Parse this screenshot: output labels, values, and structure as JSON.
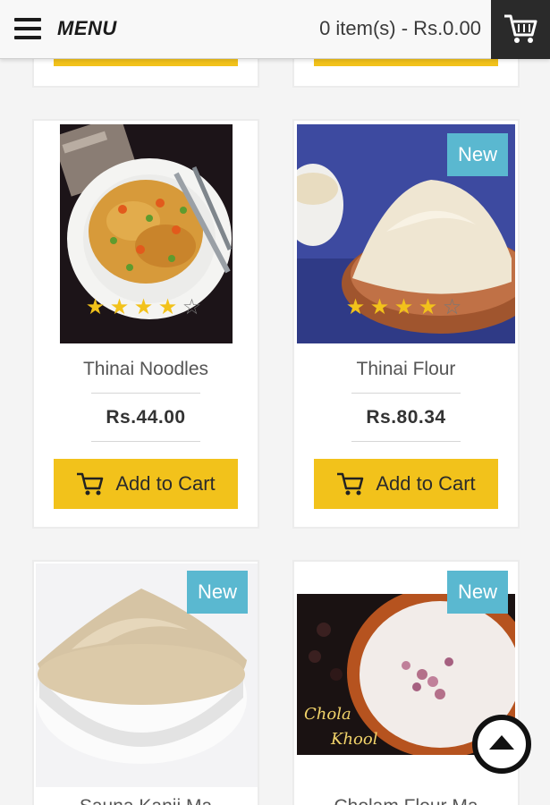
{
  "header": {
    "menu_label": "MENU",
    "cart_summary": "0 item(s) - Rs.0.00",
    "menu_icon": "hamburger-icon",
    "cart_icon": "shopping-cart-icon"
  },
  "colors": {
    "accent_yellow": "#f2c21b",
    "new_badge": "#5ab8d0",
    "header_dark": "#2a2a2a"
  },
  "products": [
    {
      "name": "Thinai Noodles",
      "price": "Rs.44.00",
      "rating": 4,
      "max_rating": 5,
      "badge": "",
      "button_label": "Add to Cart"
    },
    {
      "name": "Thinai Flour",
      "price": "Rs.80.34",
      "rating": 4,
      "max_rating": 5,
      "badge": "New",
      "button_label": "Add to Cart"
    },
    {
      "name": "Sauna Kanji Ma",
      "badge": "New"
    },
    {
      "name": "Cholam Flour Ma",
      "badge": "New",
      "image_caption_1": "Chola",
      "image_caption_2": "Khool"
    }
  ]
}
